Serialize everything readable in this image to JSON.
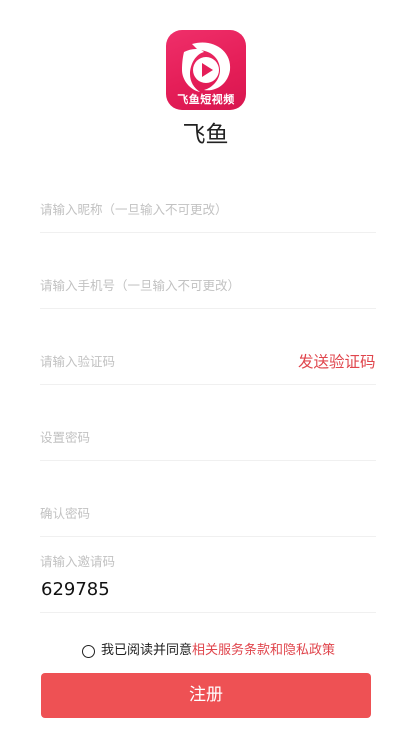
{
  "app": {
    "logo_caption": "飞鱼短视频",
    "title": "飞鱼"
  },
  "form": {
    "nickname_placeholder": "请输入昵称（一旦输入不可更改）",
    "phone_placeholder": "请输入手机号（一旦输入不可更改）",
    "code_placeholder": "请输入验证码",
    "send_code_label": "发送验证码",
    "password_placeholder": "设置密码",
    "confirm_placeholder": "确认密码",
    "invite_label": "请输入邀请码",
    "invite_value": "629785"
  },
  "agreement": {
    "prefix": "我已阅读并同意",
    "link": "相关服务条款和隐私政策",
    "checked": false
  },
  "actions": {
    "register_label": "注册"
  },
  "colors": {
    "accent": "#e0464d",
    "button": "#ee5154",
    "logo": "#e51e58"
  },
  "icons": {
    "logo": "fish-play-logo-icon",
    "radio": "radio-unchecked-icon"
  }
}
